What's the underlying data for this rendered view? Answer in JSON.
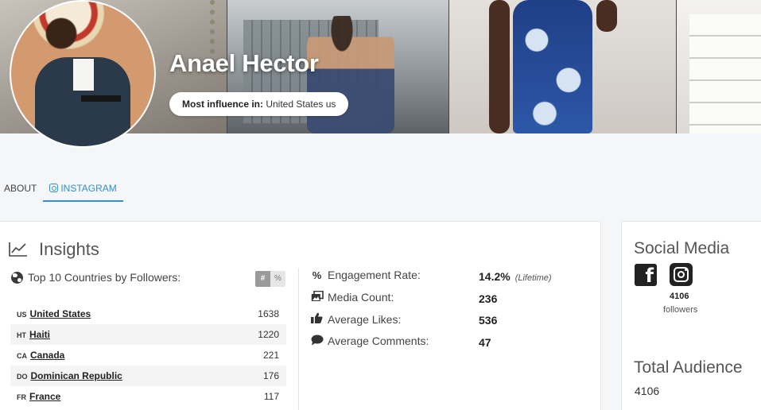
{
  "profile": {
    "name": "Anael Hector",
    "influence_label": "Most influence in:",
    "influence_value": "United States us"
  },
  "tabs": [
    {
      "label": "ABOUT",
      "active": false
    },
    {
      "label": "INSTAGRAM",
      "active": true,
      "icon": "instagram-icon"
    }
  ],
  "insights": {
    "title": "Insights",
    "countries_title": "Top 10 Countries by Followers:",
    "toggle": {
      "count_label": "#",
      "percent_label": "%",
      "selected": "#"
    },
    "countries": [
      {
        "code": "US",
        "name": "United States",
        "value": "1638"
      },
      {
        "code": "HT",
        "name": "Haiti",
        "value": "1220"
      },
      {
        "code": "CA",
        "name": "Canada",
        "value": "221"
      },
      {
        "code": "DO",
        "name": "Dominican Republic",
        "value": "176"
      },
      {
        "code": "FR",
        "name": "France",
        "value": "117"
      }
    ],
    "metrics": [
      {
        "icon": "percent-icon",
        "label": "Engagement Rate:",
        "value": "14.2%",
        "note": "(Lifetime)"
      },
      {
        "icon": "images-icon",
        "label": "Media Count:",
        "value": "236",
        "note": ""
      },
      {
        "icon": "thumbs-up-icon",
        "label": "Average Likes:",
        "value": "536",
        "note": ""
      },
      {
        "icon": "comment-icon",
        "label": "Average Comments:",
        "value": "47",
        "note": ""
      }
    ]
  },
  "social": {
    "title": "Social Media",
    "followers_count": "4106",
    "followers_label": "followers",
    "total_audience_title": "Total Audience",
    "total_audience_value": "4106"
  },
  "colors": {
    "accent": "#3490c6",
    "page_bg": "#f4f6f8",
    "card_bg": "#ffffff"
  }
}
